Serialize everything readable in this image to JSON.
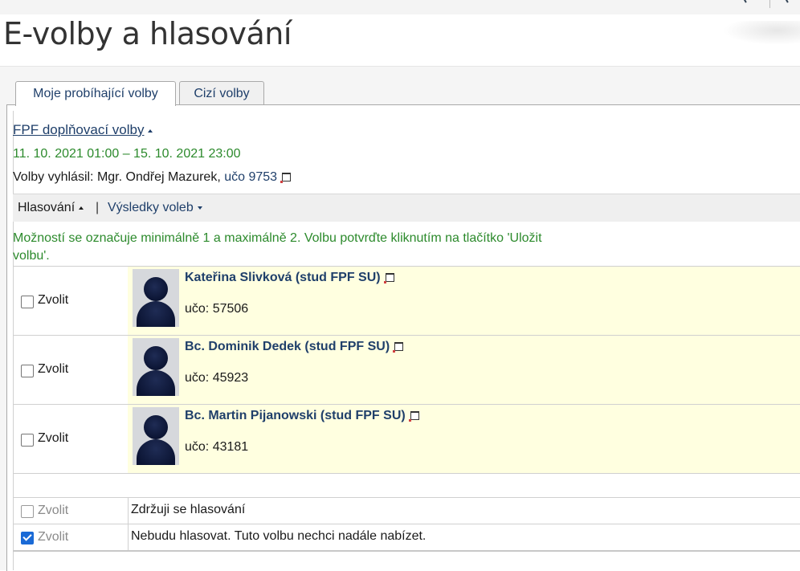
{
  "page_title": "E-volby a hlasování",
  "tabs": [
    {
      "label": "Moje probíhající volby",
      "active": true
    },
    {
      "label": "Cizí volby",
      "active": false
    }
  ],
  "election": {
    "title": "FPF doplňovací volby",
    "dates": "11. 10. 2021 01:00 – 15. 10. 2021 23:00",
    "announcer_prefix": "Volby vyhlásil: Mgr. Ondřej Mazurek,",
    "announcer_uco": "učo 9753"
  },
  "toolbar": {
    "voting": "Hlasování",
    "separator": "|",
    "results": "Výsledky voleb"
  },
  "instructions": "Možností se označuje minimálně 1 a maximálně 2. Volbu potvrďte kliknutím na tlačítko 'Uložit volbu'.",
  "candidates": [
    {
      "choose_label": "Zvolit",
      "name": "Kateřina Slivková (stud FPF SU)",
      "uco": "učo: 57506",
      "checked": false
    },
    {
      "choose_label": "Zvolit",
      "name": "Bc. Dominik Dedek (stud FPF SU)",
      "uco": "učo: 45923",
      "checked": false
    },
    {
      "choose_label": "Zvolit",
      "name": "Bc. Martin Pijanowski (stud FPF SU)",
      "uco": "učo: 43181",
      "checked": false
    }
  ],
  "options": [
    {
      "choose_label": "Zvolit",
      "text": "Zdržuji se hlasování",
      "checked": false
    },
    {
      "choose_label": "Zvolit",
      "text": "Nebudu hlasovat. Tuto volbu nechci nadále nabízet.",
      "checked": true
    }
  ],
  "colors": {
    "accent_blue": "#1f3f6a",
    "green_text": "#2c8a2c",
    "candidate_bg": "#ffffe0",
    "checkbox_checked": "#1a6ad6"
  }
}
